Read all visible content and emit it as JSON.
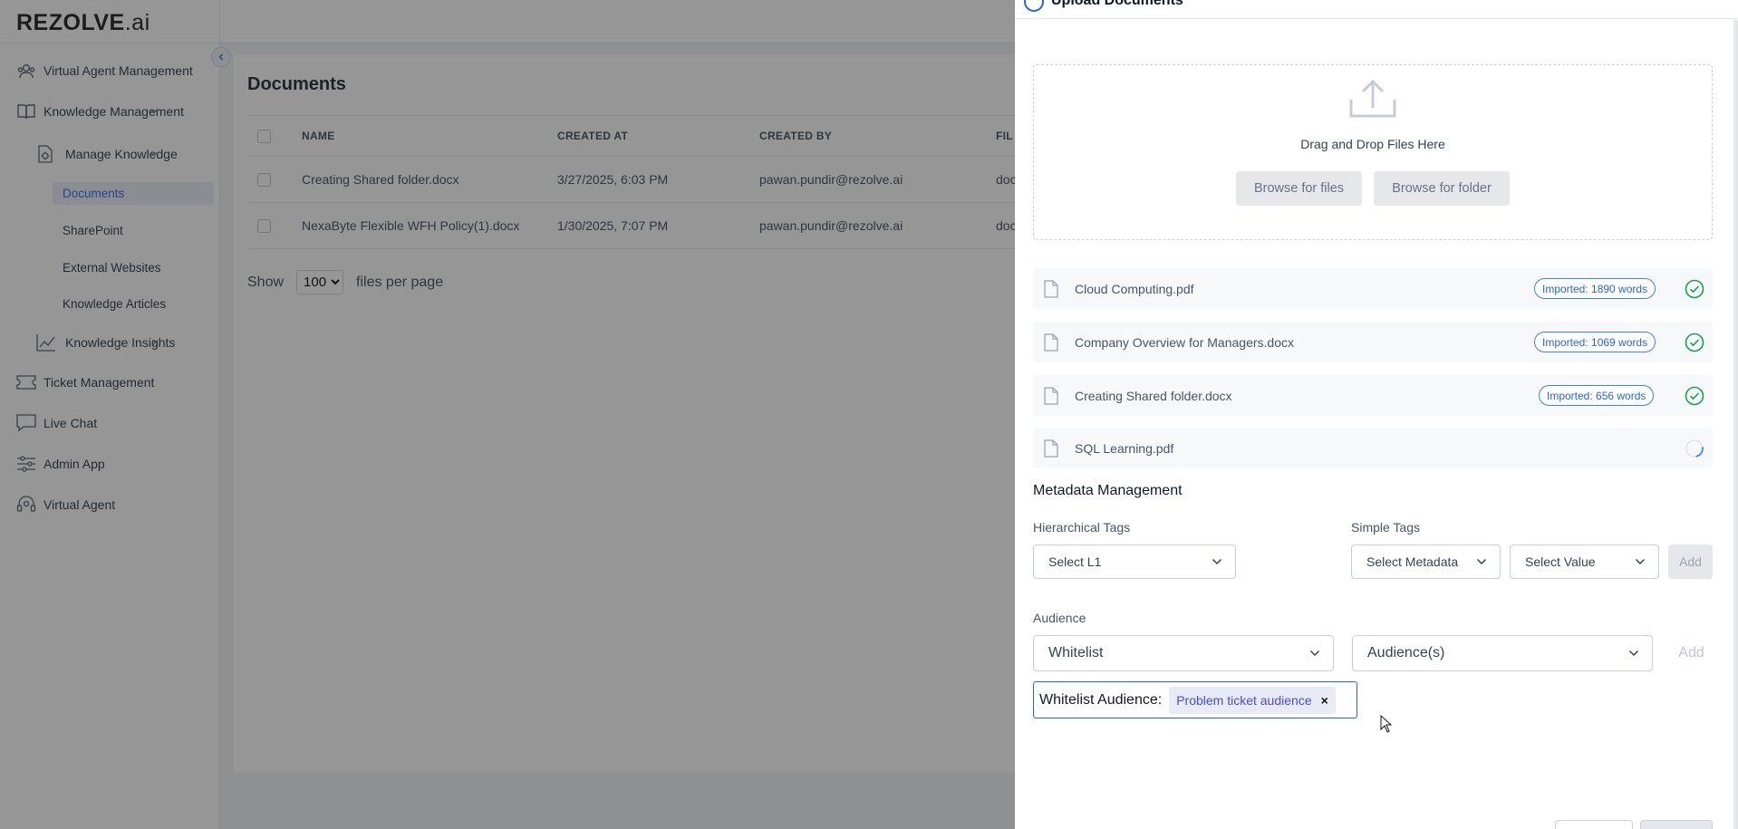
{
  "app": {
    "logo": "REZOLVE",
    "logo_suffix": ".ai"
  },
  "sidebar": {
    "items": [
      {
        "label": "Virtual Agent Management",
        "icon": "agents-icon"
      },
      {
        "label": "Knowledge Management",
        "icon": "book-icon",
        "expanded": true
      },
      {
        "label": "Manage Knowledge",
        "icon": "manage-knowledge-icon",
        "expanded": true
      },
      {
        "label": "Knowledge Insights",
        "icon": "insights-icon"
      },
      {
        "label": "Ticket Management",
        "icon": "ticket-icon"
      },
      {
        "label": "Live Chat",
        "icon": "chat-icon"
      },
      {
        "label": "Admin App",
        "icon": "sliders-icon"
      },
      {
        "label": "Virtual Agent",
        "icon": "headset-icon"
      }
    ],
    "subitems": [
      {
        "label": "Documents",
        "active": true
      },
      {
        "label": "SharePoint"
      },
      {
        "label": "External Websites"
      },
      {
        "label": "Knowledge Articles"
      }
    ]
  },
  "main": {
    "title": "Documents",
    "columns": [
      "NAME",
      "CREATED AT",
      "CREATED BY",
      "FIL"
    ],
    "rows": [
      {
        "name": "Creating Shared folder.docx",
        "created_at": "3/27/2025, 6:03 PM",
        "created_by": "pawan.pundir@rezolve.ai",
        "file": "doc"
      },
      {
        "name": "NexaByte Flexible WFH Policy(1).docx",
        "created_at": "1/30/2025, 7:07 PM",
        "created_by": "pawan.pundir@rezolve.ai",
        "file": "doc"
      }
    ],
    "pager": {
      "show": "Show",
      "per_page_value": "100",
      "suffix": "files per page"
    }
  },
  "drawer": {
    "title": "Upload Documents",
    "dropzone_text": "Drag and Drop Files Here",
    "browse_files": "Browse for files",
    "browse_folder": "Browse for folder",
    "files": [
      {
        "name": "Cloud Computing.pdf",
        "badge": "Imported: 1890 words",
        "status": "done"
      },
      {
        "name": "Company Overview for Managers.docx",
        "badge": "Imported: 1069 words",
        "status": "done"
      },
      {
        "name": "Creating Shared folder.docx",
        "badge": "Imported: 656 words",
        "status": "done"
      },
      {
        "name": "SQL Learning.pdf",
        "badge": "",
        "status": "loading"
      }
    ],
    "metadata": {
      "title": "Metadata Management",
      "hier_label": "Hierarchical Tags",
      "hier_select": "Select L1",
      "simple_label": "Simple Tags",
      "select_metadata": "Select Metadata",
      "select_value": "Select Value",
      "add": "Add"
    },
    "audience": {
      "label": "Audience",
      "type_value": "Whitelist",
      "audience_placeholder": "Audience(s)",
      "add": "Add",
      "whitelist_label": "Whitelist Audience:",
      "chips": [
        "Problem ticket audience"
      ]
    }
  },
  "colors": {
    "accent": "#2563eb",
    "success": "#16a34a",
    "overlay": "rgba(40,40,40,0.49)"
  }
}
